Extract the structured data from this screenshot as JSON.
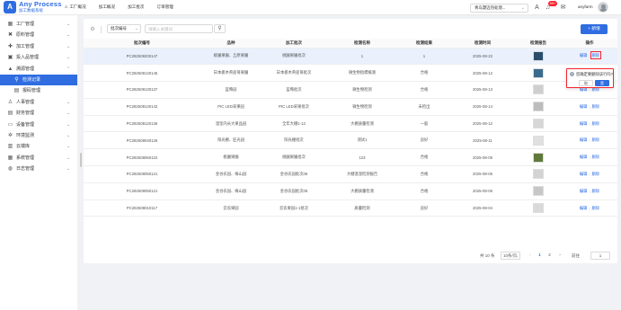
{
  "app": {
    "logo_mark": "A",
    "logo_title": "Any Process",
    "logo_subtitle": "加工数据系统",
    "brand_color": "#2f6de1"
  },
  "topnav": [
    "工厂概况",
    "加工概况",
    "加工批次",
    "订单管理"
  ],
  "header": {
    "tenant": "青岛灏迈热处理...",
    "notification_count": "99+",
    "username": "anyfarm"
  },
  "sidebar": {
    "items": [
      {
        "icon": "building-icon",
        "glyph": "▦",
        "label": "工厂管理",
        "chevron": "⌄",
        "level": 0,
        "active": false
      },
      {
        "icon": "material-icon",
        "glyph": "✖",
        "label": "原料管理",
        "chevron": "⌄",
        "level": 0,
        "active": false
      },
      {
        "icon": "process-icon",
        "glyph": "✚",
        "label": "加工管理",
        "chevron": "⌄",
        "level": 0,
        "active": false
      },
      {
        "icon": "input-icon",
        "glyph": "▣",
        "label": "投入品管理",
        "chevron": "⌄",
        "level": 0,
        "active": false
      },
      {
        "icon": "trace-icon",
        "glyph": "▲",
        "label": "溯源管理",
        "chevron": "⌃",
        "level": 0,
        "active": false
      },
      {
        "icon": "search-icon",
        "glyph": "⚲",
        "label": "检测记录",
        "chevron": "",
        "level": 1,
        "active": true
      },
      {
        "icon": "file-icon",
        "glyph": "▤",
        "label": "报码管理",
        "chevron": "",
        "level": 1,
        "active": false
      },
      {
        "icon": "person-icon",
        "glyph": "♙",
        "label": "人事管理",
        "chevron": "⌄",
        "level": 0,
        "active": false
      },
      {
        "icon": "finance-icon",
        "glyph": "▤",
        "label": "财务管理",
        "chevron": "⌄",
        "level": 0,
        "active": false
      },
      {
        "icon": "device-icon",
        "glyph": "▭",
        "label": "设备管理",
        "chevron": "⌄",
        "level": 0,
        "active": false
      },
      {
        "icon": "environment-icon",
        "glyph": "✲",
        "label": "环境监测",
        "chevron": "⌄",
        "level": 0,
        "active": false
      },
      {
        "icon": "cloud-icon",
        "glyph": "▥",
        "label": "云端库",
        "chevron": "⌄",
        "level": 0,
        "active": false
      },
      {
        "icon": "system-icon",
        "glyph": "▦",
        "label": "系统管理",
        "chevron": "⌄",
        "level": 0,
        "active": false
      },
      {
        "icon": "log-icon",
        "glyph": "◍",
        "label": "日志管理",
        "chevron": "⌄",
        "level": 0,
        "active": false
      }
    ]
  },
  "toolbar": {
    "field_select": "批次编号",
    "search_placeholder": "请输入关键词",
    "add_label": "+ 新增"
  },
  "table": {
    "headers": [
      "批次编号",
      "品种",
      "加工批次",
      "检测名称",
      "检测结果",
      "检测时间",
      "检测报告",
      "操作"
    ],
    "edit_label": "编辑",
    "delete_label": "删除",
    "rows": [
      {
        "batch": "PC282508200147",
        "variety": "桃園果園、丘原果園",
        "process": "桃園果園批次",
        "name": "1",
        "result": "1",
        "date": "2025-08-22",
        "report": "#2a4d6e",
        "highlight": true
      },
      {
        "batch": "PC282508140145",
        "variety": "日本栃木県産苺果園",
        "process": "日本栃木県産苺批次",
        "name": "微生物指標検測",
        "result": "合格",
        "date": "2025-08-12",
        "report": "#3a6b8c",
        "highlight": false
      },
      {
        "batch": "PC282508130137",
        "variety": "蓝莓园",
        "process": "蓝莓批次",
        "name": "微生物检测",
        "result": "合格",
        "date": "2025-08-13",
        "report": "#cfcfcf",
        "highlight": false
      },
      {
        "batch": "PC282508140142",
        "variety": "PIC LED采果园",
        "process": "PIC LED采果批次",
        "name": "微生物检测",
        "result": "未检出",
        "date": "2025-08-14",
        "report": "#bdbdbd",
        "highlight": false
      },
      {
        "batch": "PC282508120136",
        "variety": "温室内长大果品园",
        "process": "全年大棚1-12",
        "name": "大棚质量检测",
        "result": "一般",
        "date": "2025-08-12",
        "report": "#d7d7d7",
        "highlight": false
      },
      {
        "batch": "PC282508040126",
        "variety": "阳光棚、匠光园",
        "process": "阳光棚批次",
        "name": "测试1",
        "result": "良好",
        "date": "2025-08-11",
        "report": "#e0e0e0",
        "highlight": false
      },
      {
        "batch": "PC282508060122",
        "variety": "桃園果園",
        "process": "桃園果園批次",
        "name": "123",
        "result": "合格",
        "date": "2025-08-05",
        "report": "#5f7a3a",
        "highlight": false
      },
      {
        "batch": "PC282508050121",
        "variety": "金谷农园、梅山园",
        "process": "金谷农园批次05",
        "name": "大棚温湿检测报告",
        "result": "合格",
        "date": "2025-08-05",
        "report": "#d3d3d3",
        "highlight": false
      },
      {
        "batch": "PC282508050121",
        "variety": "金谷农园、梅山园",
        "process": "金谷农园批次05",
        "name": "大棚质量检测",
        "result": "合格",
        "date": "2025-08-06",
        "report": "#c7c7c7",
        "highlight": false
      },
      {
        "batch": "PC282508010117",
        "variety": "云农果园",
        "process": "云农果园1-1批次",
        "name": "质量检测",
        "result": "良好",
        "date": "2025-08-04",
        "report": "#d9d9d9",
        "highlight": false
      }
    ]
  },
  "popconfirm": {
    "text": "您确定要删除该行吗?",
    "icon": "question-icon",
    "cancel_label": "取",
    "ok_label": "是"
  },
  "pagination": {
    "total": "共 10 条",
    "page_size": "10条/页",
    "pages": [
      "1",
      "2"
    ],
    "current_page": "1",
    "goto_label": "前往",
    "jump_value": "1"
  }
}
